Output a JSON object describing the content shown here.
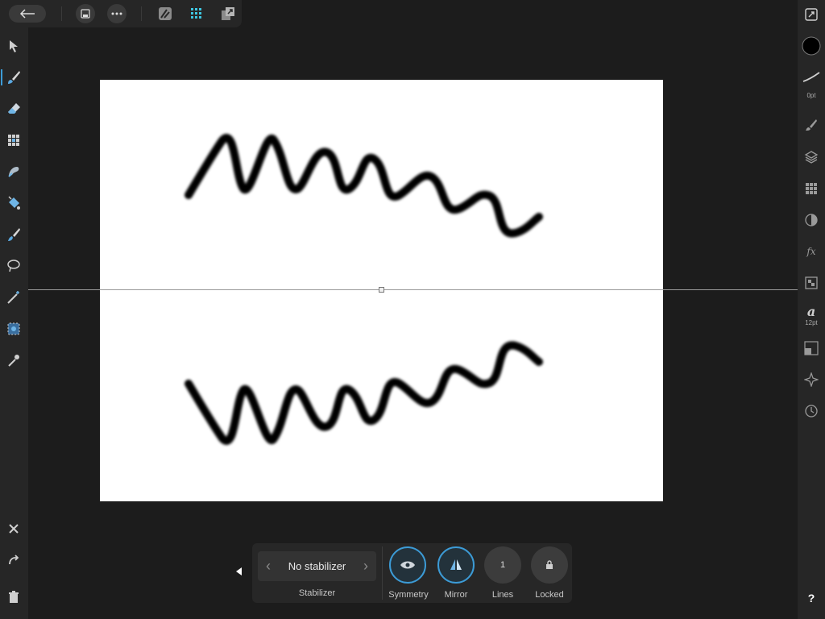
{
  "top_toolbar": {
    "back_icon": "arrow-left-icon",
    "document_icon": "document-icon",
    "more_icon": "more-icon",
    "personas": [
      "draw-persona-icon",
      "pixel-persona-icon",
      "export-persona-icon"
    ]
  },
  "left_tools": [
    "move-tool-icon",
    "brush-tool-icon",
    "eraser-tool-icon",
    "grid-tool-icon",
    "smudge-tool-icon",
    "fill-tool-icon",
    "dropper-brush-tool-icon",
    "lasso-selection-icon",
    "magic-wand-icon",
    "flood-select-icon",
    "color-picker-icon"
  ],
  "left_bottom_actions": [
    "close-icon",
    "undo-icon",
    "trash-icon"
  ],
  "right_studio": {
    "stroke_width_label": "0pt",
    "font_size_label": "12pt",
    "icons": [
      "document-resize-icon",
      "color-swatch-icon",
      "brush-stroke-icon",
      "brushes-icon",
      "layers-icon",
      "swatches-icon",
      "adjustments-icon",
      "effects-fx-icon",
      "channels-icon",
      "text-style-icon",
      "transform-icon",
      "navigator-icon",
      "history-icon"
    ]
  },
  "bottom_panel": {
    "stabilizer_value": "No stabilizer",
    "stabilizer_label": "Stabilizer",
    "symmetry_label": "Symmetry",
    "mirror_label": "Mirror",
    "lines_value": "1",
    "lines_label": "Lines",
    "locked_label": "Locked"
  },
  "help_label": "?",
  "colors": {
    "background": "#1c1c1c",
    "panel": "#262626",
    "accent": "#3c9bd6",
    "canvas": "#ffffff",
    "stroke": "#000000"
  }
}
